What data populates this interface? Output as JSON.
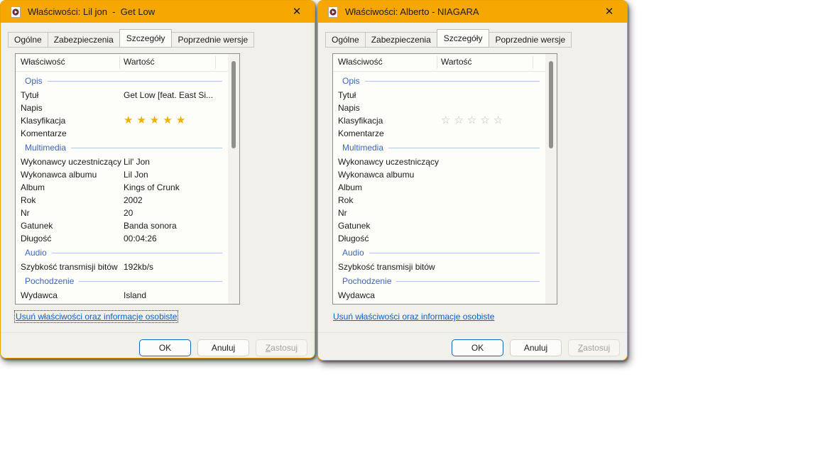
{
  "colors": {
    "titlebar": "#F7A702",
    "dialog_body": "#F1F0EA",
    "section_heading": "#3E68B5",
    "link": "#0A61C9",
    "ok_border": "#1467B8",
    "star_filled": "#F1AF00",
    "star_empty": "#BDBDB8"
  },
  "windows": [
    {
      "title": "Właściwości: Lil jon  -  Get Low",
      "close_glyph": "✕",
      "tabs": [
        {
          "label": "Ogólne",
          "active": false
        },
        {
          "label": "Zabezpieczenia",
          "active": false
        },
        {
          "label": "Szczegóły",
          "active": true
        },
        {
          "label": "Poprzednie wersje",
          "active": false
        }
      ],
      "columns": {
        "property": "Właściwość",
        "value": "Wartość"
      },
      "rows": [
        {
          "type": "section",
          "label": "Opis"
        },
        {
          "type": "prop",
          "label": "Tytuł",
          "value": "Get Low [feat. East Si..."
        },
        {
          "type": "prop",
          "label": "Napis",
          "value": ""
        },
        {
          "type": "stars",
          "label": "Klasyfikacja",
          "rating": 5,
          "max": 5
        },
        {
          "type": "prop",
          "label": "Komentarze",
          "value": ""
        },
        {
          "type": "section",
          "label": "Multimedia"
        },
        {
          "type": "prop",
          "label": "Wykonawcy uczestniczący",
          "value": "Lil' Jon"
        },
        {
          "type": "prop",
          "label": "Wykonawca albumu",
          "value": "Lil Jon"
        },
        {
          "type": "prop",
          "label": "Album",
          "value": "Kings of Crunk"
        },
        {
          "type": "prop",
          "label": "Rok",
          "value": "2002"
        },
        {
          "type": "prop",
          "label": "Nr",
          "value": "20"
        },
        {
          "type": "prop",
          "label": "Gatunek",
          "value": "Banda sonora"
        },
        {
          "type": "prop",
          "label": "Długość",
          "value": "00:04:26"
        },
        {
          "type": "section",
          "label": "Audio"
        },
        {
          "type": "prop",
          "label": "Szybkość transmisji bitów",
          "value": "192kb/s"
        },
        {
          "type": "section",
          "label": "Pochodzenie"
        },
        {
          "type": "prop",
          "label": "Wydawca",
          "value": "Island"
        }
      ],
      "link": "Usuń właściwości oraz informacje osobiste",
      "link_focused": true,
      "buttons": {
        "ok": "OK",
        "cancel": "Anuluj",
        "apply": "Zastosuj"
      }
    },
    {
      "title": "Właściwości: Alberto - NIAGARA",
      "close_glyph": "✕",
      "tabs": [
        {
          "label": "Ogólne",
          "active": false
        },
        {
          "label": "Zabezpieczenia",
          "active": false
        },
        {
          "label": "Szczegóły",
          "active": true
        },
        {
          "label": "Poprzednie wersje",
          "active": false
        }
      ],
      "columns": {
        "property": "Właściwość",
        "value": "Wartość"
      },
      "rows": [
        {
          "type": "section",
          "label": "Opis"
        },
        {
          "type": "prop",
          "label": "Tytuł",
          "value": ""
        },
        {
          "type": "prop",
          "label": "Napis",
          "value": ""
        },
        {
          "type": "stars",
          "label": "Klasyfikacja",
          "rating": 0,
          "max": 5
        },
        {
          "type": "prop",
          "label": "Komentarze",
          "value": ""
        },
        {
          "type": "section",
          "label": "Multimedia"
        },
        {
          "type": "prop",
          "label": "Wykonawcy uczestniczący",
          "value": ""
        },
        {
          "type": "prop",
          "label": "Wykonawca albumu",
          "value": ""
        },
        {
          "type": "prop",
          "label": "Album",
          "value": ""
        },
        {
          "type": "prop",
          "label": "Rok",
          "value": ""
        },
        {
          "type": "prop",
          "label": "Nr",
          "value": ""
        },
        {
          "type": "prop",
          "label": "Gatunek",
          "value": ""
        },
        {
          "type": "prop",
          "label": "Długość",
          "value": ""
        },
        {
          "type": "section",
          "label": "Audio"
        },
        {
          "type": "prop",
          "label": "Szybkość transmisji bitów",
          "value": ""
        },
        {
          "type": "section",
          "label": "Pochodzenie"
        },
        {
          "type": "prop",
          "label": "Wydawca",
          "value": ""
        }
      ],
      "link": "Usuń właściwości oraz informacje osobiste",
      "link_focused": false,
      "buttons": {
        "ok": "OK",
        "cancel": "Anuluj",
        "apply": "Zastosuj"
      }
    }
  ]
}
